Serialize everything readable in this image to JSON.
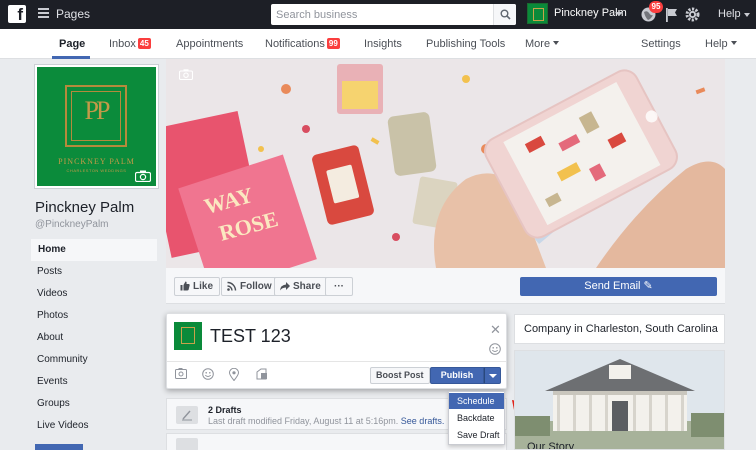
{
  "topbar": {
    "logo": "f",
    "section_label": "Pages",
    "search_placeholder": "Search business",
    "page_name": "Pinckney Palm",
    "notification_count": "95",
    "help_label": "Help"
  },
  "pagenav": {
    "tabs": [
      {
        "label": "Page",
        "active": true
      },
      {
        "label": "Inbox",
        "badge": "45"
      },
      {
        "label": "Appointments"
      },
      {
        "label": "Notifications",
        "badge": "99"
      },
      {
        "label": "Insights"
      },
      {
        "label": "Publishing Tools"
      },
      {
        "label": "More"
      },
      {
        "label": "Settings"
      },
      {
        "label": "Help"
      }
    ]
  },
  "profile": {
    "logo_text": "PINCKNEY PALM",
    "logo_subtext": "CHARLESTON WEDDINGS",
    "name": "Pinckney Palm",
    "handle": "@PinckneyPalm"
  },
  "sidenav": {
    "items": [
      "Home",
      "Posts",
      "Videos",
      "Photos",
      "About",
      "Community",
      "Events",
      "Groups",
      "Live Videos"
    ]
  },
  "actions": {
    "like": "Like",
    "follow": "Follow",
    "share": "Share",
    "more": "···",
    "send_email": "Send Email ✎"
  },
  "composer": {
    "text": "TEST 123",
    "close": "✕",
    "boost": "Boost Post",
    "publish": "Publish"
  },
  "publish_menu": {
    "options": [
      "Schedule",
      "Backdate",
      "Save Draft"
    ],
    "highlighted": "Schedule"
  },
  "drafts": {
    "title": "2 Drafts",
    "description": "Last draft modified Friday, August 11 at 5:16pm.",
    "link": "See drafts."
  },
  "about": {
    "category": "Company in Charleston, South Carolina",
    "story_title": "Our Story"
  },
  "colors": {
    "topbar": "#1d1f26",
    "accent": "#4267b2",
    "badge": "#fa3e3e",
    "brand_green": "#0b8b3b",
    "brand_gold": "#c39a48"
  }
}
